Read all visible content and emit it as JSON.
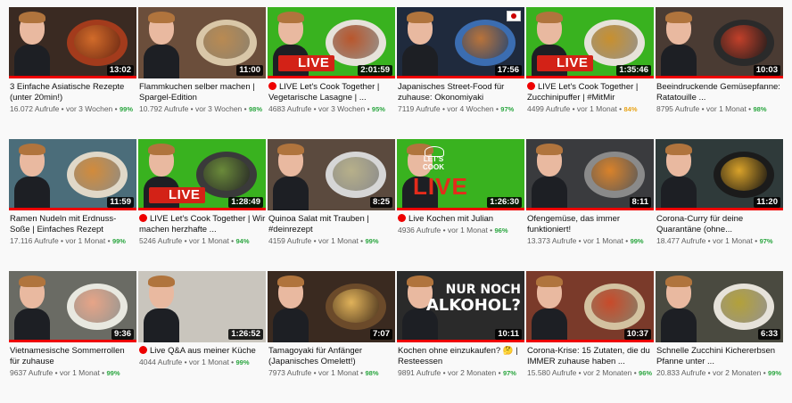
{
  "videos": [
    {
      "title": "3 Einfache Asiatische Rezepte (unter 20min!)",
      "views": "16.072 Aufrufe",
      "age": "vor 3 Wochen",
      "rating": "99%",
      "duration": "13:02",
      "live": false,
      "progress": 1.0,
      "bg": "#3a2a22",
      "dish": "#a33b1c",
      "food": "#d16b2a"
    },
    {
      "title": "Flammkuchen selber machen | Spargel-Edition",
      "views": "10.792 Aufrufe",
      "age": "vor 3 Wochen",
      "rating": "98%",
      "duration": "11:00",
      "live": false,
      "progress": 0.0,
      "bg": "#6b4e3b",
      "dish": "#d9c7a8",
      "food": "#b98a52"
    },
    {
      "title": "LIVE Let's Cook Together | Vegetarische Lasagne | ...",
      "views": "4683 Aufrufe",
      "age": "vor 3 Wochen",
      "rating": "95%",
      "duration": "2:01:59",
      "live": true,
      "live_badge": "LIVE",
      "progress": 1.0,
      "bg": "#39b21f",
      "dish": "#e6e2da",
      "food": "#b9562c"
    },
    {
      "title": "Japanisches Street-Food für zuhause: Okonomiyaki",
      "views": "7119 Aufrufe",
      "age": "vor 4 Wochen",
      "rating": "97%",
      "duration": "17:56",
      "live": false,
      "progress": 1.0,
      "bg": "#1f2a3d",
      "dish": "#3b6db1",
      "food": "#b9733a",
      "flag": true
    },
    {
      "title": "LIVE Let's Cook Together | Zucchinipuffer | #MitMir",
      "views": "4499 Aufrufe",
      "age": "vor 1 Monat",
      "rating": "84%",
      "rating_mid": true,
      "duration": "1:35:46",
      "live": true,
      "live_badge": "LIVE",
      "progress": 1.0,
      "bg": "#39b21f",
      "dish": "#e6e2da",
      "food": "#c8902e"
    },
    {
      "title": "Beeindruckende Gemüsepfanne: Ratatouille ...",
      "views": "8795 Aufrufe",
      "age": "vor 1 Monat",
      "rating": "98%",
      "duration": "10:03",
      "live": false,
      "progress": 1.0,
      "bg": "#4a3b33",
      "dish": "#2a2a2a",
      "food": "#c2402a"
    },
    {
      "title": "Ramen Nudeln mit Erdnuss-Soße | Einfaches Rezept",
      "views": "17.116 Aufrufe",
      "age": "vor 1 Monat",
      "rating": "99%",
      "duration": "11:59",
      "live": false,
      "progress": 1.0,
      "bg": "#4b6d7a",
      "dish": "#e0d8c8",
      "food": "#d28b3b"
    },
    {
      "title": "LIVE Let's Cook Together | Wir machen herzhafte ...",
      "views": "5246 Aufrufe",
      "age": "vor 1 Monat",
      "rating": "94%",
      "duration": "1:28:49",
      "live": true,
      "live_badge": "LIVE",
      "progress": 1.0,
      "bg": "#39b21f",
      "dish": "#3a3a3a",
      "food": "#6a8a3a"
    },
    {
      "title": "Quinoa Salat mit Trauben | #deinrezept",
      "views": "4159 Aufrufe",
      "age": "vor 1 Monat",
      "rating": "99%",
      "duration": "8:25",
      "live": false,
      "progress": 0.0,
      "bg": "#5b4a3e",
      "dish": "#d6d6d6",
      "food": "#b7b08a"
    },
    {
      "title": "Live Kochen mit Julian",
      "views": "4936 Aufrufe",
      "age": "vor 1 Monat",
      "rating": "96%",
      "duration": "1:26:30",
      "live": true,
      "live_big": "LIVE",
      "lets_cook": "LET'S COOK",
      "progress": 1.0,
      "bg": "#39b21f",
      "dish": "",
      "food": ""
    },
    {
      "title": "Ofengemüse, das immer funktioniert!",
      "views": "13.373 Aufrufe",
      "age": "vor 1 Monat",
      "rating": "99%",
      "duration": "8:11",
      "live": false,
      "progress": 1.0,
      "bg": "#3a3b3e",
      "dish": "#8a8a8a",
      "food": "#d9822a"
    },
    {
      "title": "Corona-Curry für deine Quarantäne (ohne...",
      "views": "18.477 Aufrufe",
      "age": "vor 1 Monat",
      "rating": "97%",
      "duration": "11:20",
      "live": false,
      "progress": 1.0,
      "bg": "#2f3a3a",
      "dish": "#1b1b1b",
      "food": "#d9a22a"
    },
    {
      "title": "Vietnamesische Sommerrollen für zuhause",
      "views": "9637 Aufrufe",
      "age": "vor 1 Monat",
      "rating": "99%",
      "duration": "9:36",
      "live": false,
      "progress": 1.0,
      "bg": "#6a6b64",
      "dish": "#e8e8e0",
      "food": "#e7a487"
    },
    {
      "title": "Live Q&A aus meiner Küche",
      "views": "4044 Aufrufe",
      "age": "vor 1 Monat",
      "rating": "99%",
      "duration": "1:26:52",
      "live": true,
      "progress": 0.0,
      "bg": "#c9c5bd",
      "dish": "",
      "food": ""
    },
    {
      "title": "Tamagoyaki für Anfänger (Japanisches Omelett!)",
      "views": "7973 Aufrufe",
      "age": "vor 1 Monat",
      "rating": "98%",
      "duration": "7:07",
      "live": false,
      "progress": 0.0,
      "bg": "#3a2a20",
      "dish": "#6b4a2a",
      "food": "#e0b25a"
    },
    {
      "title": "Kochen ohne einzukaufen? 🤔 | Resteessen",
      "views": "9891 Aufrufe",
      "age": "vor 2 Monaten",
      "rating": "97%",
      "duration": "10:11",
      "live": false,
      "progress": 1.0,
      "bg": "#2a2a2a",
      "dish": "",
      "food": "",
      "big_text": [
        "NUR NOCH",
        "ALKOHOL?"
      ]
    },
    {
      "title": "Corona-Krise: 15 Zutaten, die du IMMER zuhause haben ...",
      "views": "15.580 Aufrufe",
      "age": "vor 2 Monaten",
      "rating": "96%",
      "duration": "10:37",
      "live": false,
      "progress": 1.0,
      "bg": "#7a3a2a",
      "dish": "#d3c2a0",
      "food": "#c84a2a"
    },
    {
      "title": "Schnelle Zucchini Kichererbsen Pfanne unter ...",
      "views": "20.833 Aufrufe",
      "age": "vor 2 Monaten",
      "rating": "99%",
      "duration": "6:33",
      "live": false,
      "progress": 0.0,
      "bg": "#4a4a40",
      "dish": "#e6e2da",
      "food": "#b3a13a"
    }
  ]
}
